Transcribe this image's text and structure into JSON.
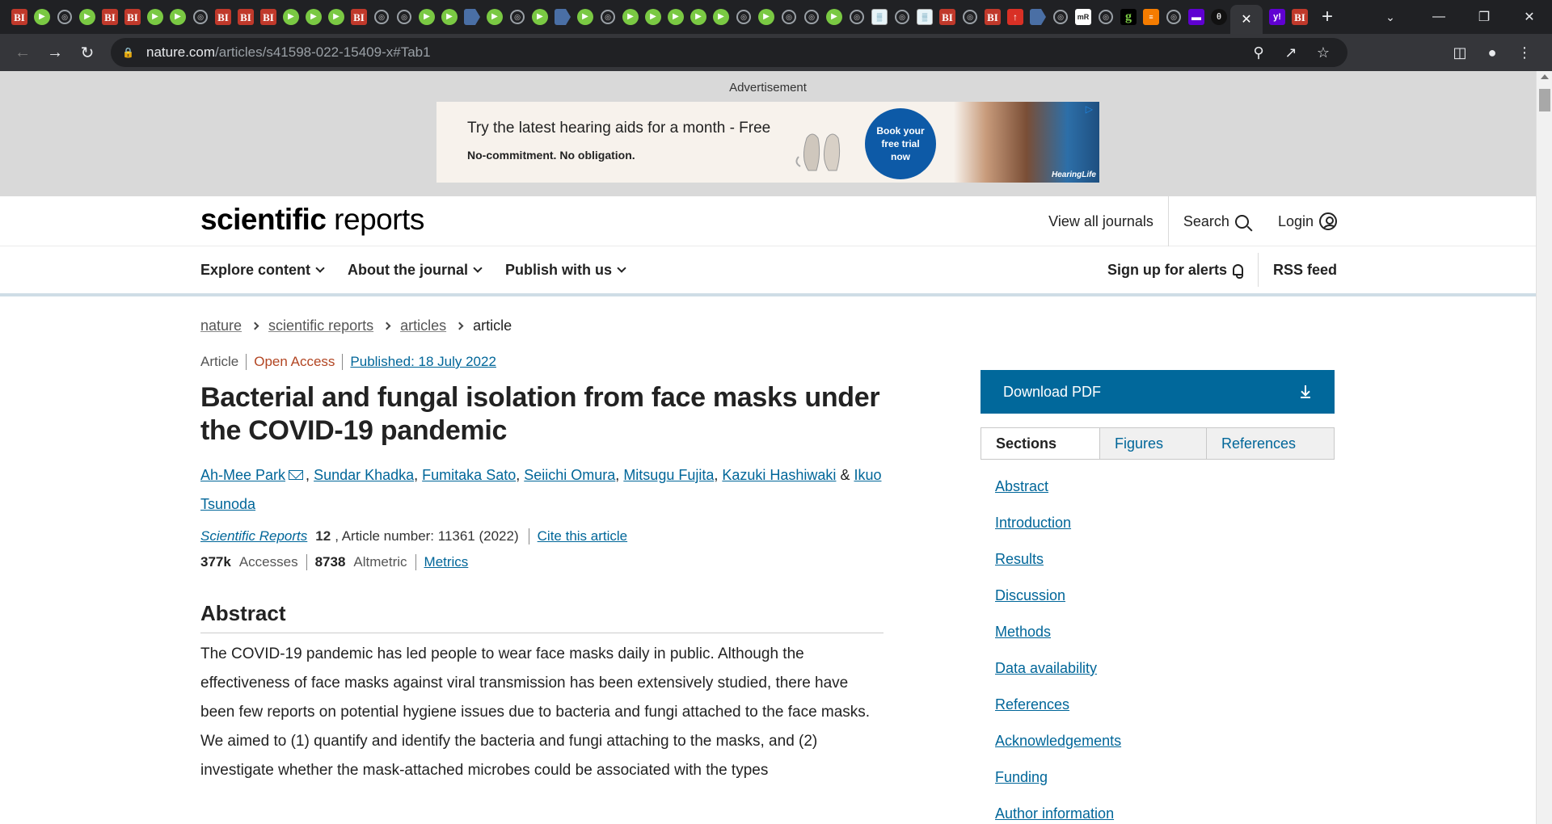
{
  "browser": {
    "favicons": [
      "bi",
      "play",
      "globe",
      "play",
      "bi",
      "bi",
      "play",
      "play",
      "globe",
      "bi",
      "bi",
      "bi",
      "play",
      "play",
      "play",
      "bi",
      "globe",
      "globe",
      "play",
      "play",
      "flag",
      "play",
      "globe",
      "play",
      "flag",
      "play",
      "globe",
      "play",
      "play",
      "play",
      "play",
      "play",
      "globe",
      "play",
      "globe",
      "globe",
      "play",
      "globe",
      "grid",
      "globe",
      "grid",
      "bi",
      "globe",
      "bi",
      "red",
      "flag",
      "globe",
      "mr",
      "globe",
      "g",
      "bars",
      "globe",
      "purple",
      "theta"
    ],
    "active_tab_close": "✕",
    "trailing_favicons": [
      "yahoo",
      "bi"
    ],
    "new_tab": "+",
    "url_domain": "nature.com",
    "url_path": "/articles/s41598-022-15409-x#Tab1"
  },
  "ad": {
    "label": "Advertisement",
    "headline": "Try the latest hearing aids for a month - Free",
    "subline": "No-commitment. No obligation.",
    "cta": "Book your free trial now",
    "brand": "HearingLife"
  },
  "header": {
    "logo_bold": "scientific",
    "logo_light": " reports",
    "view_all": "View all journals",
    "search": "Search",
    "login": "Login"
  },
  "nav": {
    "explore": "Explore content",
    "about": "About the journal",
    "publish": "Publish with us",
    "alerts": "Sign up for alerts",
    "rss": "RSS feed"
  },
  "breadcrumb": [
    "nature",
    "scientific reports",
    "articles",
    "article"
  ],
  "article": {
    "type": "Article",
    "access": "Open Access",
    "published": "Published: 18 July 2022",
    "title": "Bacterial and fungal isolation from face masks under the COVID-19 pandemic",
    "authors": [
      "Ah-Mee Park",
      "Sundar Khadka",
      "Fumitaka Sato",
      "Seiichi Omura",
      "Mitsugu Fujita",
      "Kazuki Hashiwaki",
      "Ikuo Tsunoda"
    ],
    "journal": "Scientific Reports",
    "volume": "12",
    "article_number": ", Article number: 11361 (2022)",
    "cite": "Cite this article",
    "accesses_value": "377k",
    "accesses_label": "Accesses",
    "altmetric_value": "8738",
    "altmetric_label": "Altmetric",
    "metrics": "Metrics",
    "abstract_heading": "Abstract",
    "abstract_text": "The COVID-19 pandemic has led people to wear face masks daily in public. Although the effectiveness of face masks against viral transmission has been extensively studied, there have been few reports on potential hygiene issues due to bacteria and fungi attached to the face masks. We aimed to (1) quantify and identify the bacteria and fungi attaching to the masks, and (2) investigate whether the mask-attached microbes could be associated with the types"
  },
  "sidebar": {
    "download": "Download PDF",
    "tabs": [
      "Sections",
      "Figures",
      "References"
    ],
    "sections": [
      "Abstract",
      "Introduction",
      "Results",
      "Discussion",
      "Methods",
      "Data availability",
      "References",
      "Acknowledgements",
      "Funding",
      "Author information"
    ]
  }
}
